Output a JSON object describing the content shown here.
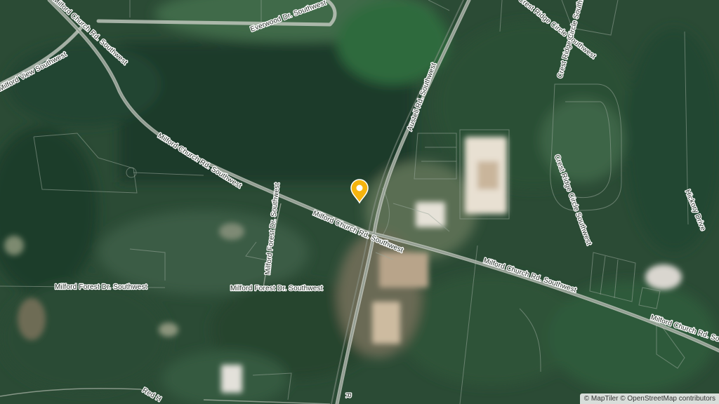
{
  "map": {
    "attribution": "© MapTiler © OpenStreetMap contributors",
    "colors": {
      "vegetation_dark": "#1e3b2b",
      "vegetation_mid": "#2f5a3d",
      "vegetation_light": "#4f7a55",
      "road_casing": "#c9ccc4",
      "road_fill": "#9aa59b",
      "marker": "#f6b40e"
    },
    "roads": [
      {
        "id": "milford-church-1",
        "label": "Milford Church Rd. Southwest"
      },
      {
        "id": "milford-church-2",
        "label": "Milford Church Rd. Southwest"
      },
      {
        "id": "milford-church-3",
        "label": "Milford Church Rd. Southwest"
      },
      {
        "id": "milford-church-4",
        "label": "Milford Church Rd. Southwest"
      },
      {
        "id": "milford-church-5",
        "label": "Milford Church Rd. Southwest"
      },
      {
        "id": "austell-rd",
        "label": "Austell Rd. Southwest"
      },
      {
        "id": "everwood-dr",
        "label": "Everwood Dr. Southwest"
      },
      {
        "id": "milford-view",
        "label": "Milford View Southwest"
      },
      {
        "id": "milford-forest-1",
        "label": "Milford Forest Dr. Southwest"
      },
      {
        "id": "milford-forest-2",
        "label": "Milford Forest Dr. Southwest"
      },
      {
        "id": "milford-forest-3",
        "label": "Milford Forest Dr. Southwest"
      },
      {
        "id": "crest-ridge-1",
        "label": "Crest Ridge Circle Southwest"
      },
      {
        "id": "crest-ridge-2",
        "label": "Crest Ridge Circle Southwest"
      },
      {
        "id": "crest-ridge-3",
        "label": "Crest Ridge Circle Southwest"
      },
      {
        "id": "hickory-dr",
        "label": "Hickory Drive"
      },
      {
        "id": "red-h",
        "label": "Red H"
      },
      {
        "id": "bottom-rd",
        "label": "R"
      }
    ],
    "marker": {
      "icon": "location-pin-icon"
    }
  }
}
